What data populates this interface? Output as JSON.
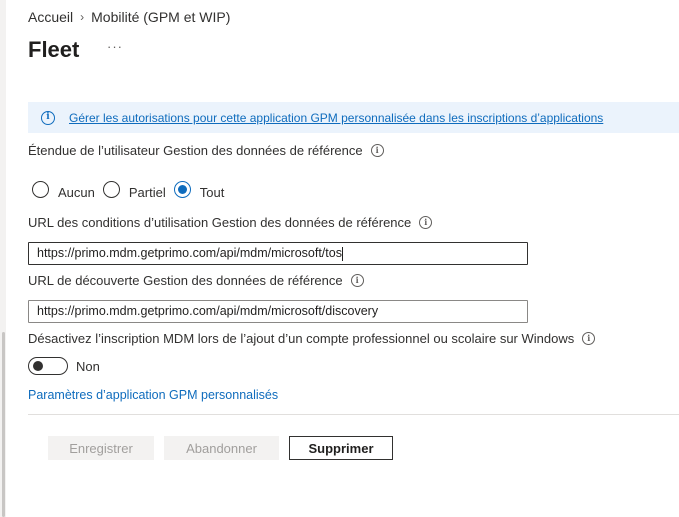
{
  "breadcrumb": {
    "home": "Accueil",
    "separator": "›",
    "current": "Mobilité (GPM et WIP)"
  },
  "page": {
    "title": "Fleet",
    "more_label": "···"
  },
  "banner": {
    "icon": "info-icon",
    "glyph": "i",
    "link_text": "Gérer les autorisations pour cette application GPM personnalisée dans les inscriptions d’applications"
  },
  "user_scope": {
    "label": "Étendue de l’utilisateur Gestion des données de référence",
    "options": [
      {
        "label": "Aucun",
        "checked": false
      },
      {
        "label": "Partiel",
        "checked": false
      },
      {
        "label": "Tout",
        "checked": true
      }
    ]
  },
  "tos_url": {
    "label": "URL des conditions d’utilisation Gestion des données de référence",
    "value": "https://primo.mdm.getprimo.com/api/mdm/microsoft/tos"
  },
  "discovery_url": {
    "label": "URL de découverte Gestion des données de référence",
    "value": "https://primo.mdm.getprimo.com/api/mdm/microsoft/discovery"
  },
  "disable_mdm": {
    "label": "Désactivez l’inscription MDM lors de l’ajout d’un compte professionnel ou scolaire sur Windows",
    "toggle_label": "Non",
    "toggle_on": false
  },
  "custom_settings_link": "Paramètres d’application GPM personnalisés",
  "buttons": {
    "save": "Enregistrer",
    "discard": "Abandonner",
    "delete": "Supprimer"
  },
  "colors": {
    "accent": "#0f6cbd",
    "banner_bg": "#ebf3fc",
    "text": "#323130"
  }
}
